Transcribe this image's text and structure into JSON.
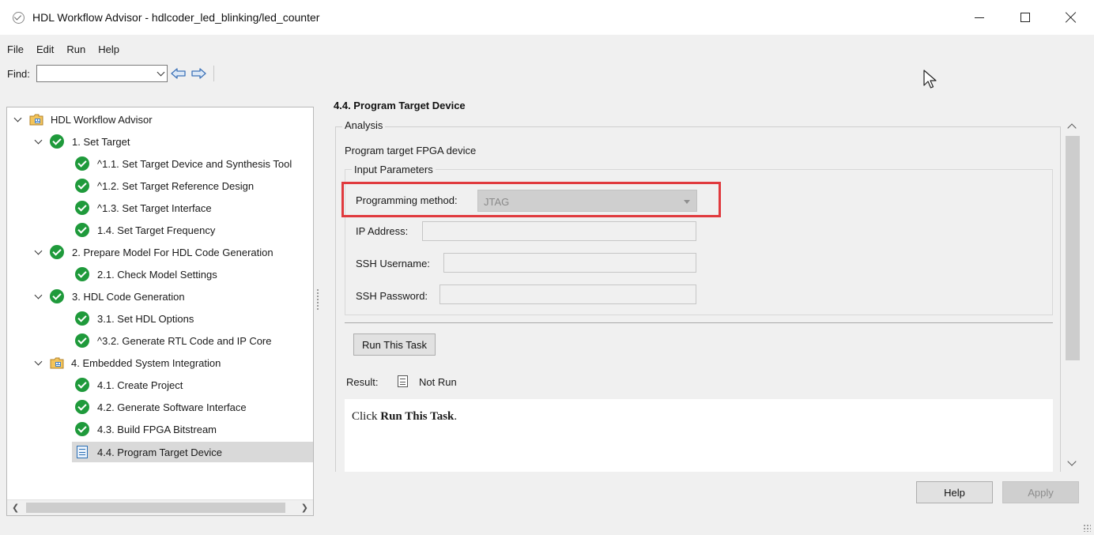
{
  "window": {
    "title": "HDL Workflow Advisor - hdlcoder_led_blinking/led_counter"
  },
  "menu": [
    "File",
    "Edit",
    "Run",
    "Help"
  ],
  "find": {
    "label": "Find:",
    "value": ""
  },
  "tree": {
    "items": [
      {
        "label": "HDL Workflow Advisor",
        "level": 0,
        "expanded": true,
        "icon": "folder-icon"
      },
      {
        "label": "1. Set Target",
        "level": 1,
        "expanded": true,
        "icon": "check-icon"
      },
      {
        "label": "^1.1. Set Target Device and Synthesis Tool",
        "level": 2,
        "icon": "check-icon"
      },
      {
        "label": "^1.2. Set Target Reference Design",
        "level": 2,
        "icon": "check-icon"
      },
      {
        "label": "^1.3. Set Target Interface",
        "level": 2,
        "icon": "check-icon"
      },
      {
        "label": "1.4. Set Target Frequency",
        "level": 2,
        "icon": "check-icon"
      },
      {
        "label": "2. Prepare Model For HDL Code Generation",
        "level": 1,
        "expanded": true,
        "icon": "check-icon"
      },
      {
        "label": "2.1. Check Model Settings",
        "level": 2,
        "icon": "check-icon"
      },
      {
        "label": "3. HDL Code Generation",
        "level": 1,
        "expanded": true,
        "icon": "check-icon"
      },
      {
        "label": "3.1. Set HDL Options",
        "level": 2,
        "icon": "check-icon"
      },
      {
        "label": "^3.2. Generate RTL Code and IP Core",
        "level": 2,
        "icon": "check-icon"
      },
      {
        "label": "4. Embedded System Integration",
        "level": 1,
        "expanded": true,
        "icon": "folder-icon"
      },
      {
        "label": "4.1. Create Project",
        "level": 2,
        "icon": "check-icon"
      },
      {
        "label": "4.2. Generate Software Interface",
        "level": 2,
        "icon": "check-icon"
      },
      {
        "label": "4.3. Build FPGA Bitstream",
        "level": 2,
        "icon": "check-icon"
      },
      {
        "label": "4.4. Program Target Device",
        "level": 2,
        "icon": "document-icon",
        "selected": true
      }
    ]
  },
  "main": {
    "title": "4.4. Program Target Device",
    "analysis_label": "Analysis",
    "description": "Program target FPGA device",
    "input_parameters_label": "Input Parameters",
    "programming_method": {
      "label": "Programming method:",
      "value": "JTAG"
    },
    "ip_address": {
      "label": "IP Address:",
      "value": ""
    },
    "ssh_username": {
      "label": "SSH Username:",
      "value": ""
    },
    "ssh_password": {
      "label": "SSH Password:",
      "value": ""
    },
    "run_button": "Run This Task",
    "result": {
      "label": "Result:",
      "status": "Not Run"
    },
    "message": {
      "prefix": "Click ",
      "bold": "Run This Task",
      "suffix": "."
    }
  },
  "footer": {
    "help": "Help",
    "apply": "Apply"
  },
  "colors": {
    "highlight": "#e03a3e",
    "check": "#1f9a3b",
    "selected_row": "#d9d9d9"
  }
}
